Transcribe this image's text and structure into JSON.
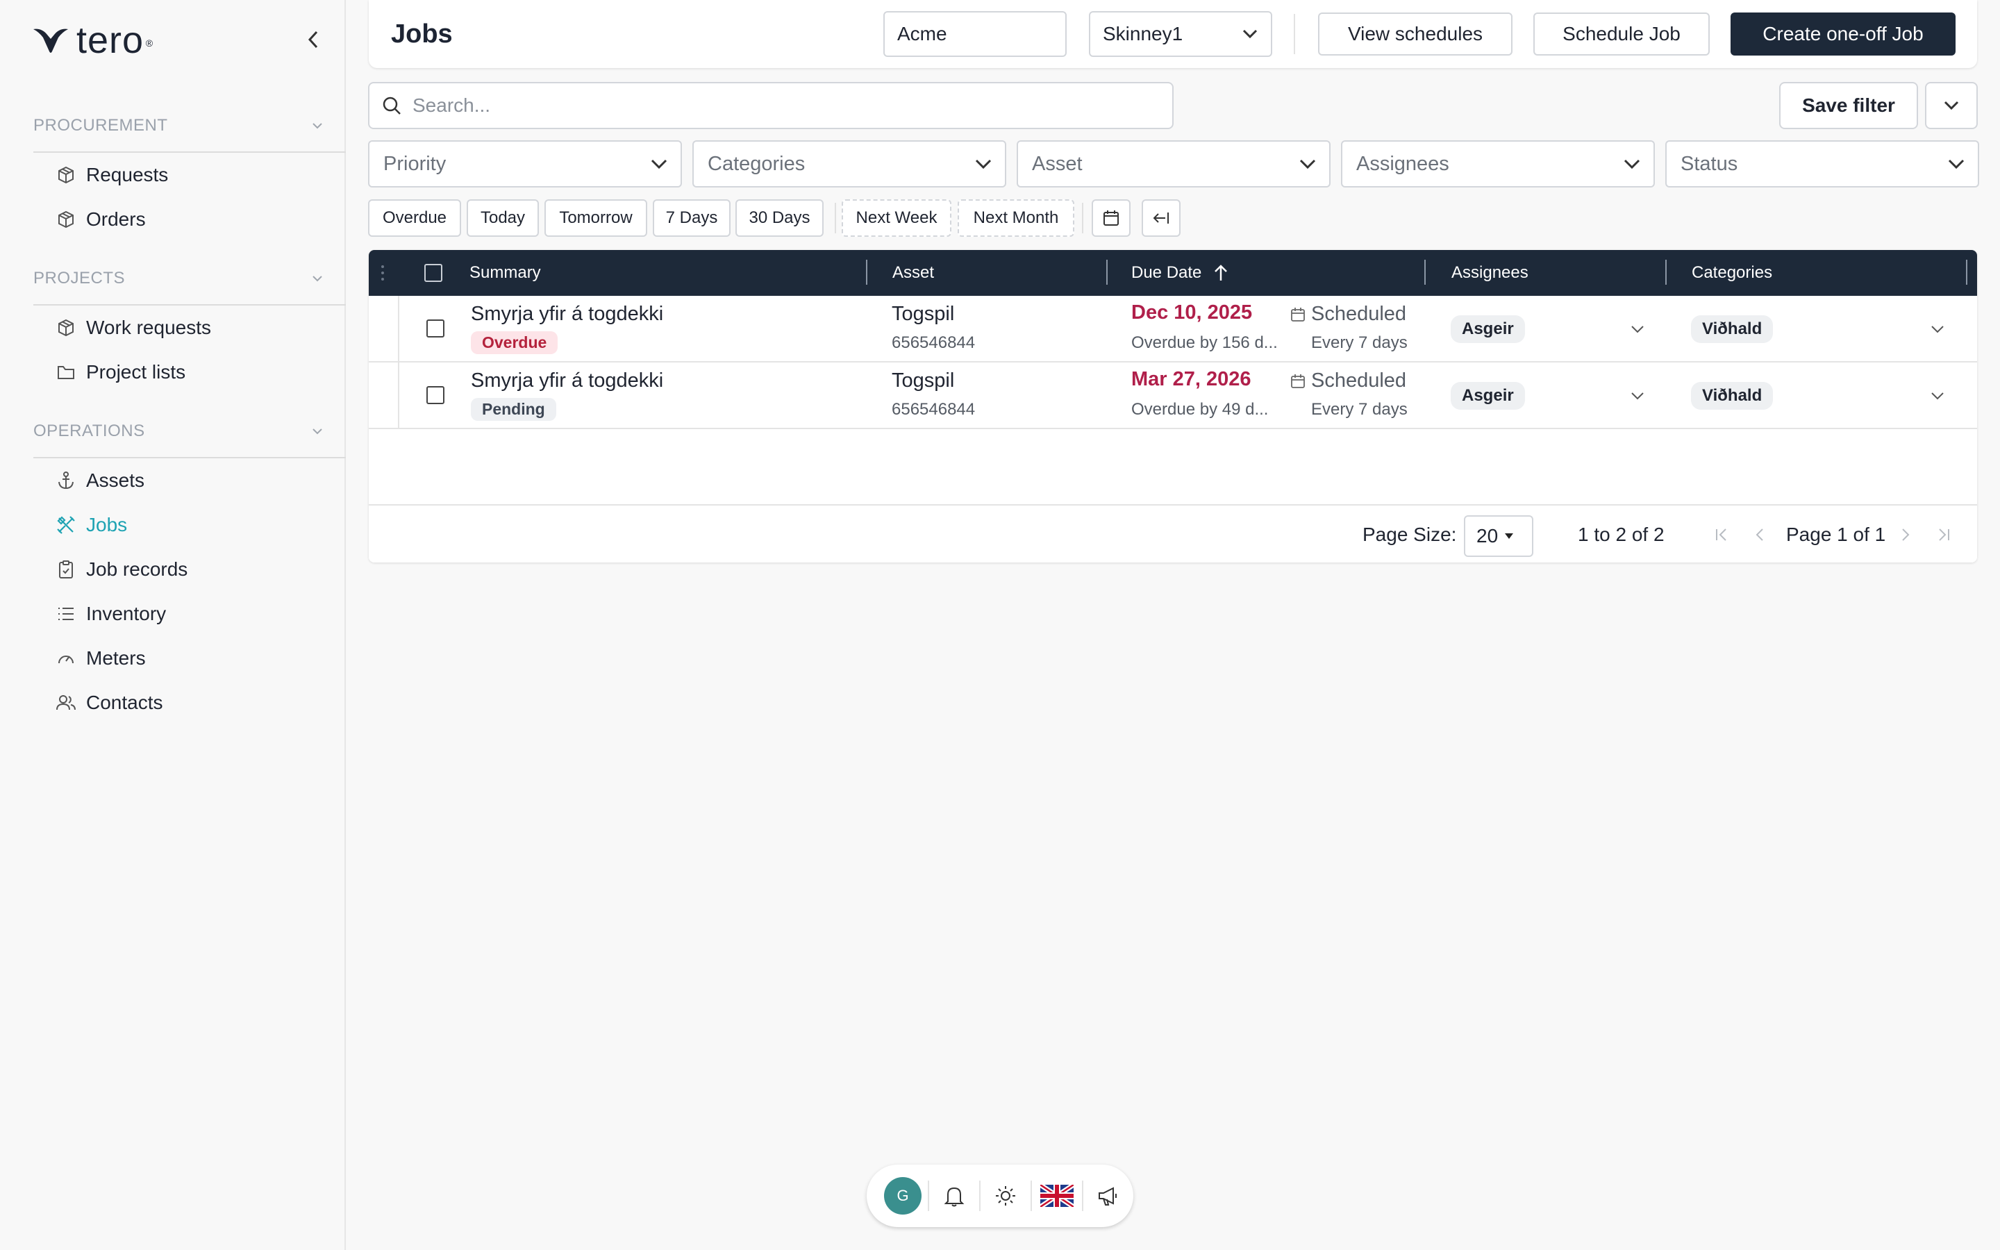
{
  "brand": {
    "name": "tero",
    "mark": "®"
  },
  "sidebar": {
    "sections": [
      {
        "title": "PROCUREMENT",
        "items": [
          {
            "label": "Requests",
            "icon": "box-icon"
          },
          {
            "label": "Orders",
            "icon": "box-icon"
          }
        ]
      },
      {
        "title": "PROJECTS",
        "items": [
          {
            "label": "Work requests",
            "icon": "box-icon"
          },
          {
            "label": "Project lists",
            "icon": "folder-icon"
          }
        ]
      },
      {
        "title": "OPERATIONS",
        "items": [
          {
            "label": "Assets",
            "icon": "anchor-icon"
          },
          {
            "label": "Jobs",
            "icon": "tools-icon",
            "active": true
          },
          {
            "label": "Job records",
            "icon": "clipboard-icon"
          },
          {
            "label": "Inventory",
            "icon": "list-icon"
          },
          {
            "label": "Meters",
            "icon": "gauge-icon"
          },
          {
            "label": "Contacts",
            "icon": "users-icon"
          }
        ]
      }
    ]
  },
  "header": {
    "title": "Jobs",
    "company": "Acme",
    "site": "Skinney1",
    "view_schedules": "View schedules",
    "schedule_job": "Schedule Job",
    "create_job": "Create one-off Job"
  },
  "search": {
    "placeholder": "Search...",
    "save_filter": "Save filter"
  },
  "filters": [
    "Priority",
    "Categories",
    "Asset",
    "Assignees",
    "Status"
  ],
  "quick_filters": [
    "Overdue",
    "Today",
    "Tomorrow",
    "7 Days",
    "30 Days",
    "Next Week",
    "Next Month"
  ],
  "table": {
    "columns": [
      "Summary",
      "Asset",
      "Due Date",
      "Assignees",
      "Categories"
    ],
    "rows": [
      {
        "summary": "Smyrja yfir á togdekki",
        "status": "Overdue",
        "asset": "Togspil",
        "asset_id": "656546844",
        "due": "Dec 10, 2025",
        "due_note": "Overdue by 156 d...",
        "schedule": "Scheduled",
        "interval": "Every 7 days",
        "assignee": "Asgeir",
        "category": "Viðhald"
      },
      {
        "summary": "Smyrja yfir á togdekki",
        "status": "Pending",
        "asset": "Togspil",
        "asset_id": "656546844",
        "due": "Mar 27, 2026",
        "due_note": "Overdue by 49 d...",
        "schedule": "Scheduled",
        "interval": "Every 7 days",
        "assignee": "Asgeir",
        "category": "Viðhald"
      }
    ],
    "pager": {
      "page_size_label": "Page Size:",
      "page_size": "20",
      "range": "1 to 2 of 2",
      "page": "Page 1 of 1"
    }
  },
  "bottombar": {
    "avatar": "G"
  },
  "colors": {
    "accent": "#1fa3b3",
    "dark": "#1d2939",
    "overdue": "#b01f4a"
  }
}
